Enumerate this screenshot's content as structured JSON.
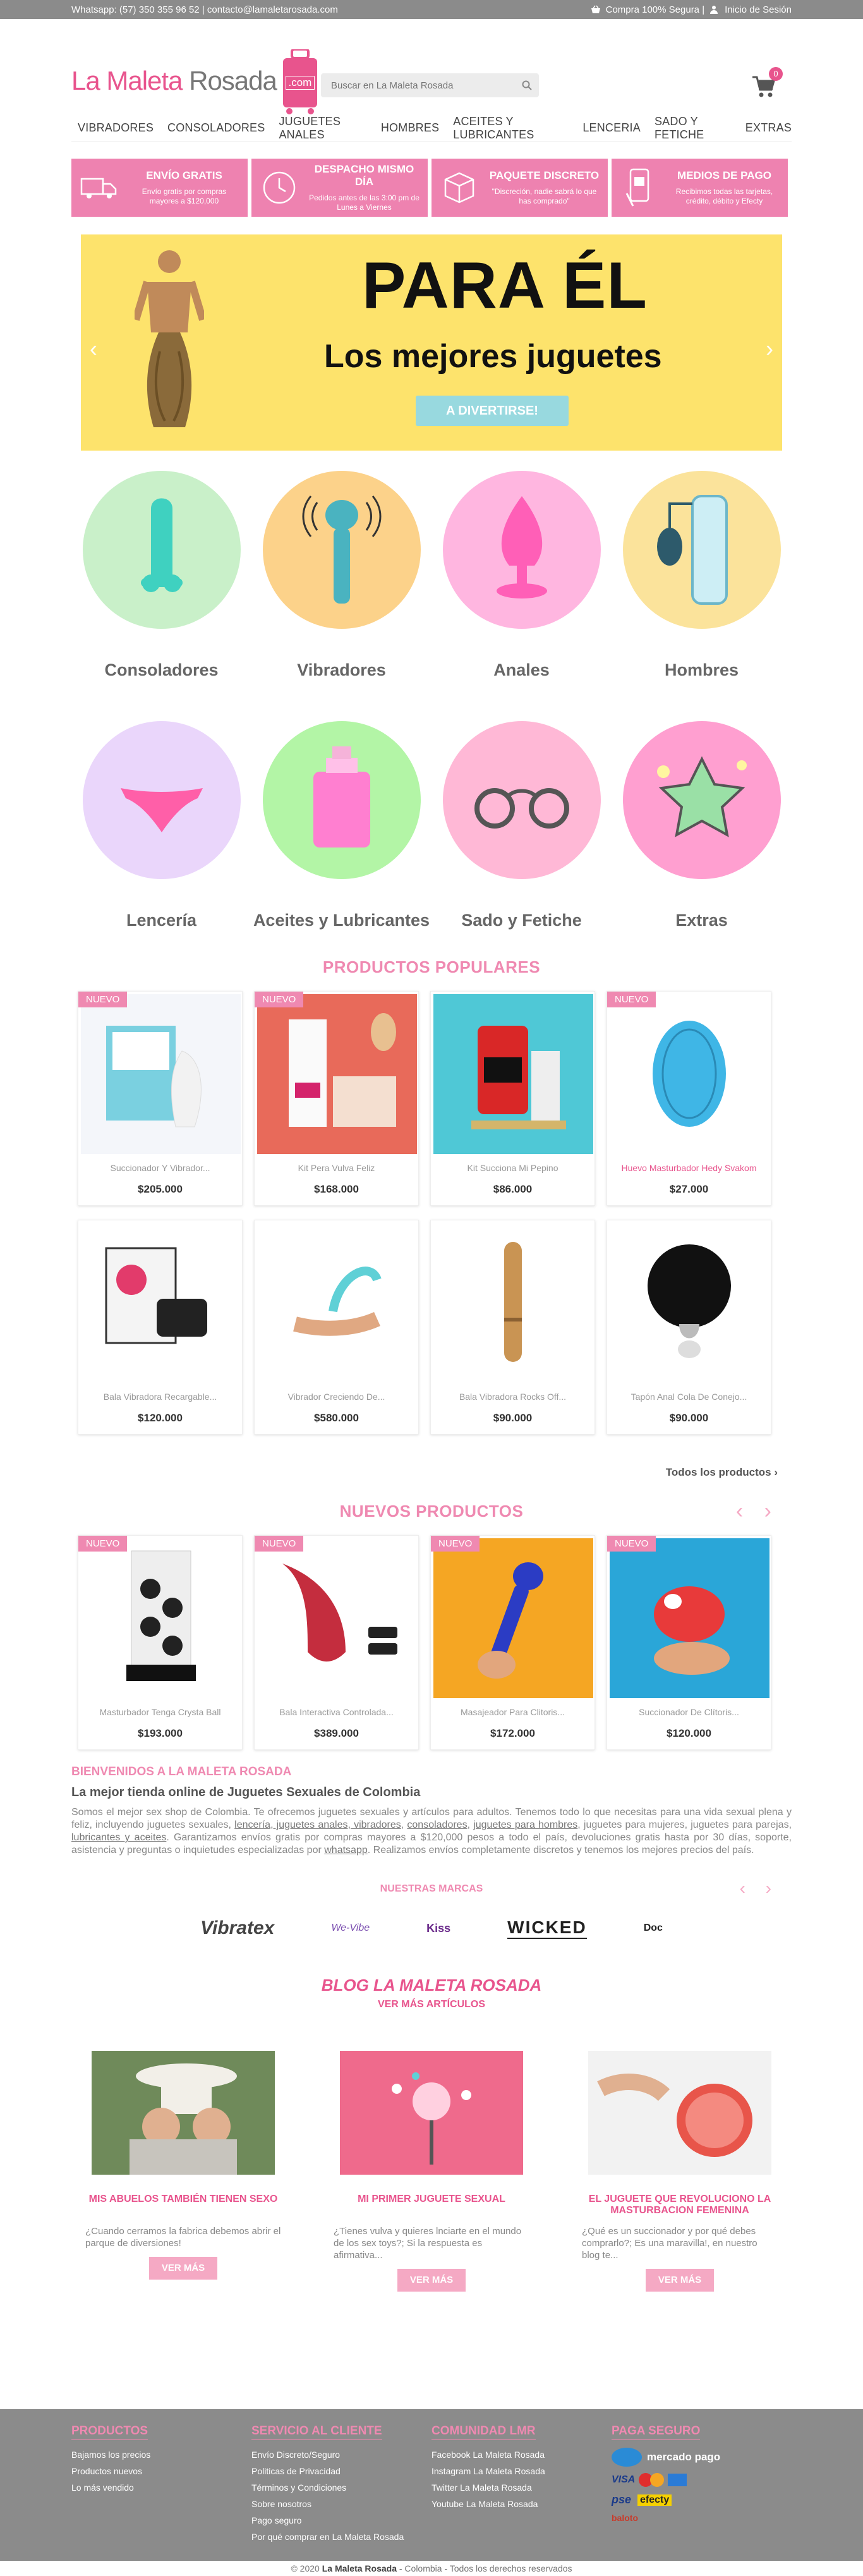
{
  "topbar": {
    "contact": "Whatsapp: (57) 350 355 96 52 | contacto@lamaletarosada.com",
    "secure": "Compra 100% Segura |",
    "login": "Inicio de Sesión"
  },
  "header": {
    "logo_part1": "La Maleta",
    "logo_part2": " Rosada",
    "logo_badge": ".com",
    "search_placeholder": "Buscar en La Maleta Rosada",
    "cart_count": "0"
  },
  "nav": [
    "VIBRADORES",
    "CONSOLADORES",
    "JUGUETES ANALES",
    "HOMBRES",
    "ACEITES Y LUBRICANTES",
    "LENCERIA",
    "SADO Y FETICHE",
    "EXTRAS"
  ],
  "infos": [
    {
      "title": "ENVÍO GRATIS",
      "desc": "Envío gratis por compras mayores a $120,000"
    },
    {
      "title": "DESPACHO MISMO DÍA",
      "desc": "Pedidos antes de las 3:00 pm de Lunes a Viernes"
    },
    {
      "title": "PAQUETE DISCRETO",
      "desc": "\"Discreción, nadie sabrá lo que has comprado\""
    },
    {
      "title": "MEDIOS DE PAGO",
      "desc": "Recibimos todas las tarjetas, crédito, débito y Efecty"
    }
  ],
  "hero": {
    "title": "PARA ÉL",
    "subtitle": "Los mejores juguetes",
    "button": "A DIVERTIRSE!"
  },
  "categories": [
    {
      "name": "Consoladores",
      "color": "#c9f0c9"
    },
    {
      "name": "Vibradores",
      "color": "#fcd28a"
    },
    {
      "name": "Anales",
      "color": "#ffb6e0"
    },
    {
      "name": "Hombres",
      "color": "#fbe39b"
    },
    {
      "name": "Lencería",
      "color": "#ead6fb"
    },
    {
      "name": "Aceites y Lubricantes",
      "color": "#b3f5a6"
    },
    {
      "name": "Sado y Fetiche",
      "color": "#ffb8d6"
    },
    {
      "name": "Extras",
      "color": "#ff9fd0"
    }
  ],
  "popular": {
    "title": "PRODUCTOS POPULARES",
    "items": [
      {
        "tag": "NUEVO",
        "name": "Succionador Y Vibrador...",
        "price": "$205.000"
      },
      {
        "tag": "NUEVO",
        "name": "Kit Pera Vulva Feliz",
        "price": "$168.000"
      },
      {
        "tag": "",
        "name": "Kit Succiona Mi Pepino",
        "price": "$86.000"
      },
      {
        "tag": "NUEVO",
        "name": "Huevo Masturbador Hedy Svakom",
        "price": "$27.000"
      },
      {
        "tag": "",
        "name": "Bala Vibradora Recargable...",
        "price": "$120.000"
      },
      {
        "tag": "",
        "name": "Vibrador Creciendo De...",
        "price": "$580.000"
      },
      {
        "tag": "",
        "name": "Bala Vibradora Rocks Off...",
        "price": "$90.000"
      },
      {
        "tag": "",
        "name": "Tapón Anal Cola De Conejo...",
        "price": "$90.000"
      }
    ],
    "all_link": "Todos los productos ›"
  },
  "newproducts": {
    "title": "NUEVOS PRODUCTOS",
    "items": [
      {
        "tag": "NUEVO",
        "name": "Masturbador Tenga Crysta Ball",
        "price": "$193.000"
      },
      {
        "tag": "NUEVO",
        "name": "Bala Interactiva Controlada...",
        "price": "$389.000"
      },
      {
        "tag": "NUEVO",
        "name": "Masajeador Para Clitoris...",
        "price": "$172.000"
      },
      {
        "tag": "NUEVO",
        "name": "Succionador De Clítoris...",
        "price": "$120.000"
      }
    ]
  },
  "about": {
    "title": "BIENVENIDOS A LA MALETA ROSADA",
    "subtitle": "La mejor tienda online de Juguetes Sexuales de Colombia",
    "text1": "Somos el mejor sex shop de Colombia. Te ofrecemos juguetes sexuales y artículos para adultos. Tenemos todo lo que necesitas para una vida sexual plena y feliz, incluyendo juguetes sexuales, ",
    "link1": "lencería, juguetes anales, vibradores",
    "text2": ", ",
    "link2": "consoladores",
    "text3": ", ",
    "link3": "juguetes para hombres",
    "text4": ", juguetes para mujeres, juguetes para parejas, ",
    "link4": "lubricantes y aceites",
    "text5": ". Garantizamos envíos gratis por compras mayores a $120,000 pesos a todo el país, devoluciones gratis hasta por 30 días, soporte, asistencia y preguntas o inquietudes especializadas por ",
    "link5": "whatsapp",
    "text6": ". Realizamos envíos completamente discretos y tenemos los mejores precios del país."
  },
  "brands": {
    "title": "NUESTRAS MARCAS",
    "items": [
      "Vibratex",
      "We-Vibe",
      "Kiss",
      "WICKED",
      "Doc"
    ]
  },
  "blog": {
    "title": "BLOG LA MALETA ROSADA",
    "more": "VER MÁS ARTÍCULOS",
    "posts": [
      {
        "title": "MIS ABUELOS TAMBIÉN TIENEN SEXO",
        "excerpt": "¿Cuando cerramos la fabrica debemos abrir el parque de diversiones!",
        "button": "VER MÁS"
      },
      {
        "title": "MI PRIMER JUGUETE SEXUAL",
        "excerpt": "¿Tienes vulva y quieres lnciarte en el mundo de los sex toys?; Si la respuesta es afirmativa...",
        "button": "VER MÁS"
      },
      {
        "title": "EL JUGUETE QUE REVOLUCIONO LA MASTURBACION FEMENINA",
        "excerpt": "¿Qué es un succionador y por qué debes comprarlo?; Es una maravilla!, en nuestro blog te...",
        "button": "VER MÁS"
      }
    ]
  },
  "footer": {
    "cols": [
      {
        "title": "PRODUCTOS",
        "items": [
          "Bajamos los precios",
          "Productos nuevos",
          "Lo más vendido"
        ]
      },
      {
        "title": "SERVICIO AL CLIENTE",
        "items": [
          "Envío Discreto/Seguro",
          "Politicas de Privacidad",
          "Términos y Condiciones",
          "Sobre nosotros",
          "Pago seguro",
          "Por qué comprar en La Maleta Rosada"
        ]
      },
      {
        "title": "COMUNIDAD LMR",
        "items": [
          "Facebook La Maleta Rosada",
          "Instagram La Maleta Rosada",
          "Twitter La Maleta Rosada",
          "Youtube La Maleta Rosada"
        ]
      },
      {
        "title": "PAGA SEGURO",
        "items": [
          "mercado pago",
          "VISA",
          "pse",
          "efecty",
          "baloto"
        ]
      }
    ],
    "copyright_pre": "© 2020 ",
    "copyright_brand": "La Maleta Rosada",
    "copyright_post": " - Colombia - Todos los derechos reservados"
  }
}
